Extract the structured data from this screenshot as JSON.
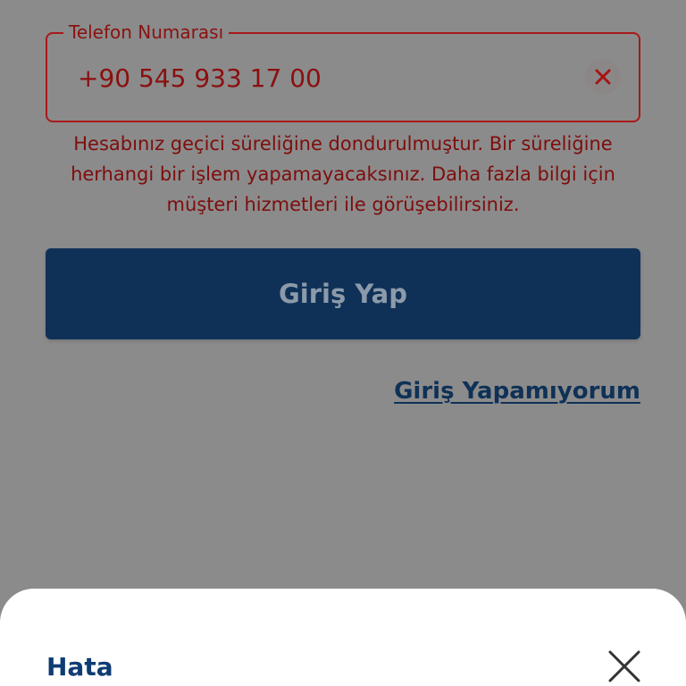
{
  "login_form": {
    "phone_field": {
      "label": "Telefon Numarası",
      "value": "+90 545 933 17 00"
    },
    "error_message": "Hesabınız geçici süreliğine dondurulmuştur. Bir süreliğine herhangi bir işlem yapamayacaksınız. Daha fazla bilgi için müşteri hizmetleri ile görüşebilirsiniz.",
    "login_button_label": "Giriş Yap",
    "help_link_label": "Giriş Yapamıyorum"
  },
  "bottom_sheet": {
    "title": "Hata"
  },
  "colors": {
    "error_red": "#a81919",
    "primary_navy": "#0f3157",
    "sheet_title_blue": "#0f3c73",
    "backdrop_gray": "#8b8b8b"
  },
  "icons": {
    "clear": "close-icon",
    "sheet_close": "close-icon"
  }
}
